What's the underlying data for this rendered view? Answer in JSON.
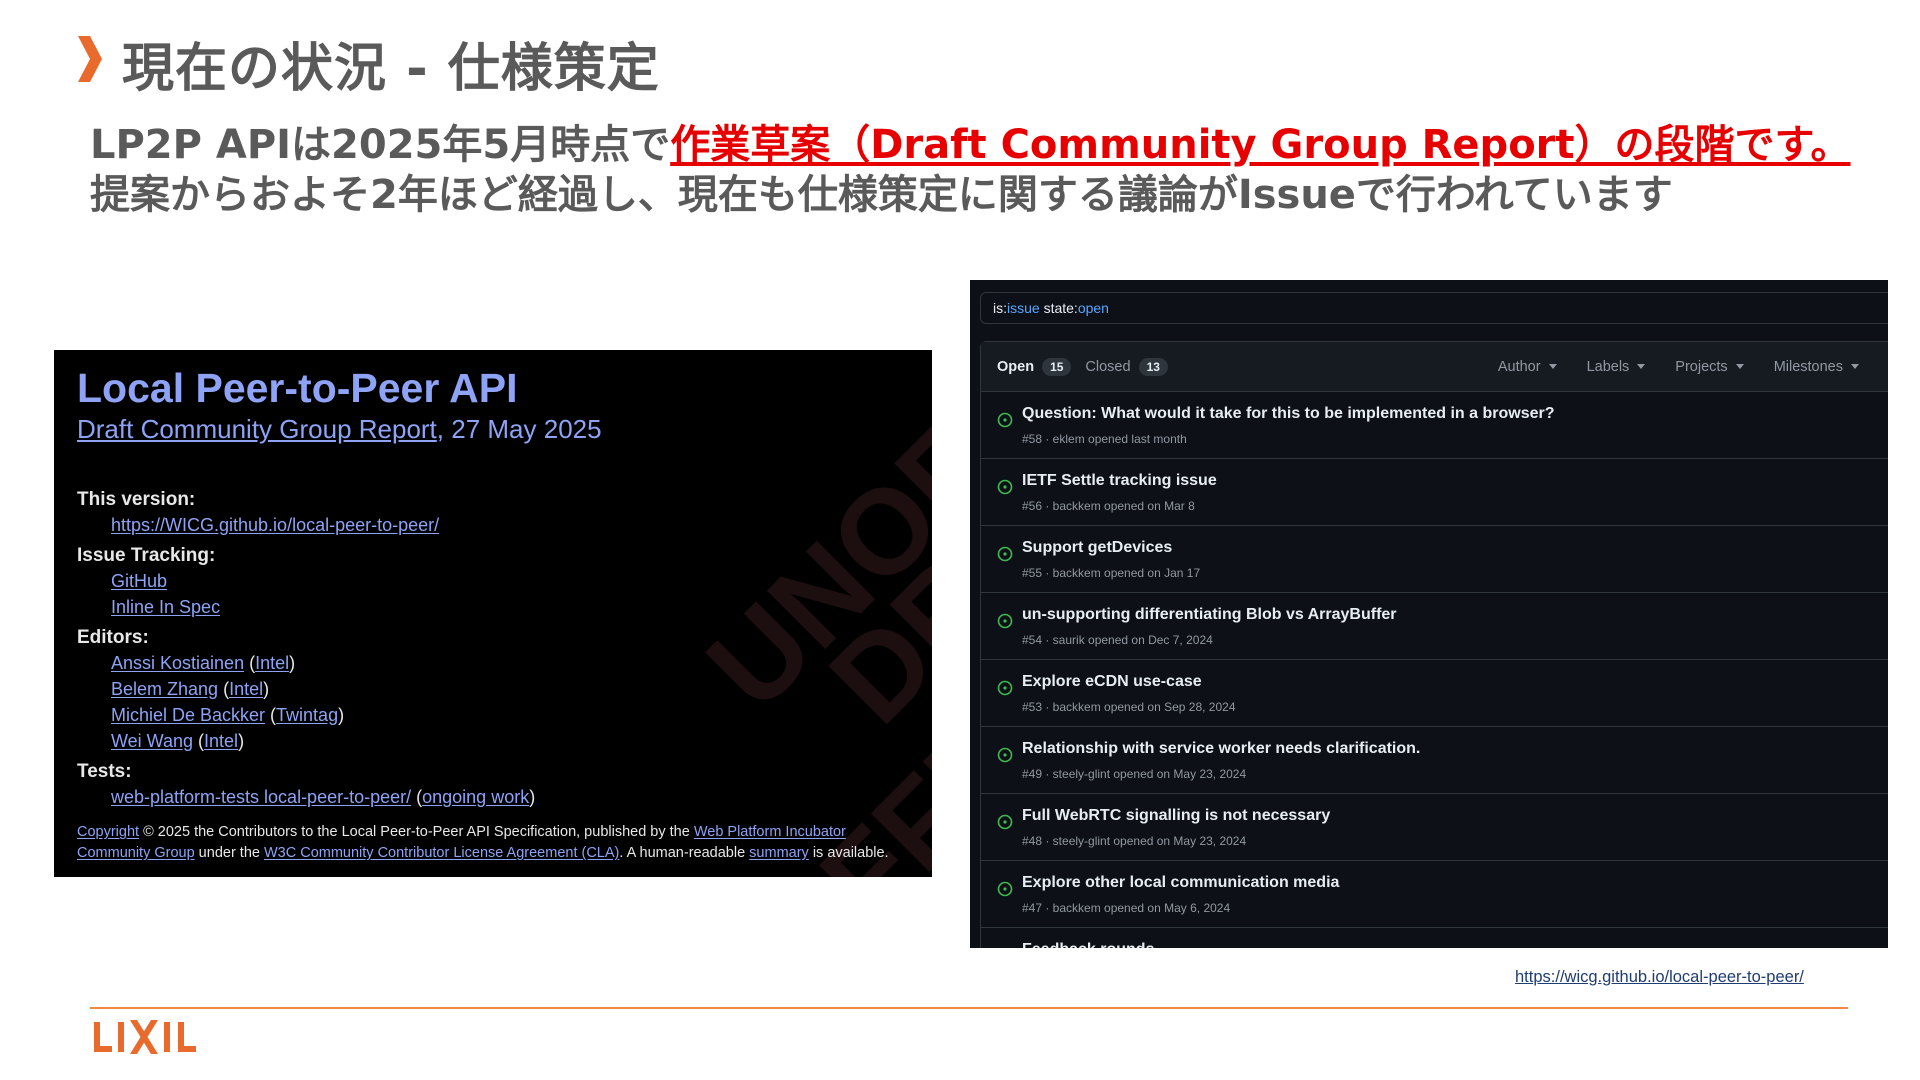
{
  "slide": {
    "title": "現在の状況 - 仕様策定",
    "lead_line1_prefix": "LP2P APIは2025年5月時点で",
    "lead_line1_highlight": "作業草案（Draft Community Group Report）の段階です。",
    "lead_line2": "提案からおよそ2年ほど経過し、現在も仕様策定に関する議論がIssueで行われています",
    "source_link": "https://wicg.github.io/local-peer-to-peer/",
    "logo_text": "LIXIL",
    "colors": {
      "accent": "#e60000",
      "rule": "#ee8844",
      "logo": "#e86a2c",
      "chevron": "#e86a2c"
    }
  },
  "spec": {
    "title": "Local Peer-to-Peer API",
    "status_link": "Draft Community Group Report",
    "date": ", 27 May 2025",
    "watermark1": "UNOFFI",
    "watermark2": "DRA",
    "watermark3": "OFFIC",
    "this_version_label": "This version:",
    "this_version_url": "https://WICG.github.io/local-peer-to-peer/",
    "issue_tracking_label": "Issue Tracking:",
    "issue_github": "GitHub",
    "issue_inline": "Inline In Spec",
    "editors_label": "Editors:",
    "editors": [
      {
        "name": "Anssi Kostiainen",
        "org": "Intel"
      },
      {
        "name": "Belem Zhang",
        "org": "Intel"
      },
      {
        "name": "Michiel De Backker",
        "org": "Twintag"
      },
      {
        "name": "Wei Wang",
        "org": "Intel"
      }
    ],
    "tests_label": "Tests:",
    "tests_link": "web-platform-tests local-peer-to-peer/",
    "tests_note": "ongoing work",
    "copyright_link": "Copyright",
    "copyright_text1": " © 2025 the Contributors to the Local Peer-to-Peer API Specification, published by the ",
    "wpi_link": "Web Platform Incubator Community Group",
    "copyright_text2": " under the ",
    "cla_link": "W3C Community Contributor License Agreement (CLA)",
    "copyright_text3": ". A human-readable ",
    "summary_link": "summary",
    "copyright_text4": " is available."
  },
  "github": {
    "search_prefix": "is:",
    "search_kw1": "issue",
    "search_mid": " state:",
    "search_kw2": "open",
    "open_label": "Open",
    "open_count": "15",
    "closed_label": "Closed",
    "closed_count": "13",
    "filters": [
      "Author",
      "Labels",
      "Projects",
      "Milestones"
    ],
    "issues": [
      {
        "title": "Question: What would it take for this to be implemented in a browser?",
        "meta": "#58 · eklem opened last month"
      },
      {
        "title": "IETF Settle tracking issue",
        "meta": "#56 · backkem opened on Mar 8"
      },
      {
        "title": "Support getDevices",
        "meta": "#55 · backkem opened on Jan 17"
      },
      {
        "title": "un-supporting differentiating Blob vs ArrayBuffer",
        "meta": "#54 · saurik opened on Dec 7, 2024"
      },
      {
        "title": "Explore eCDN use-case",
        "meta": "#53 · backkem opened on Sep 28, 2024"
      },
      {
        "title": "Relationship with service worker needs clarification.",
        "meta": "#49 · steely-glint opened on May 23, 2024"
      },
      {
        "title": "Full WebRTC signalling is not necessary",
        "meta": "#48 · steely-glint opened on May 23, 2024"
      },
      {
        "title": "Explore other local communication media",
        "meta": "#47 · backkem opened on May 6, 2024"
      },
      {
        "title": "Feedback rounds",
        "meta": ""
      }
    ],
    "colors": {
      "open_icon": "#3fb950",
      "link": "#58a6ff"
    }
  }
}
